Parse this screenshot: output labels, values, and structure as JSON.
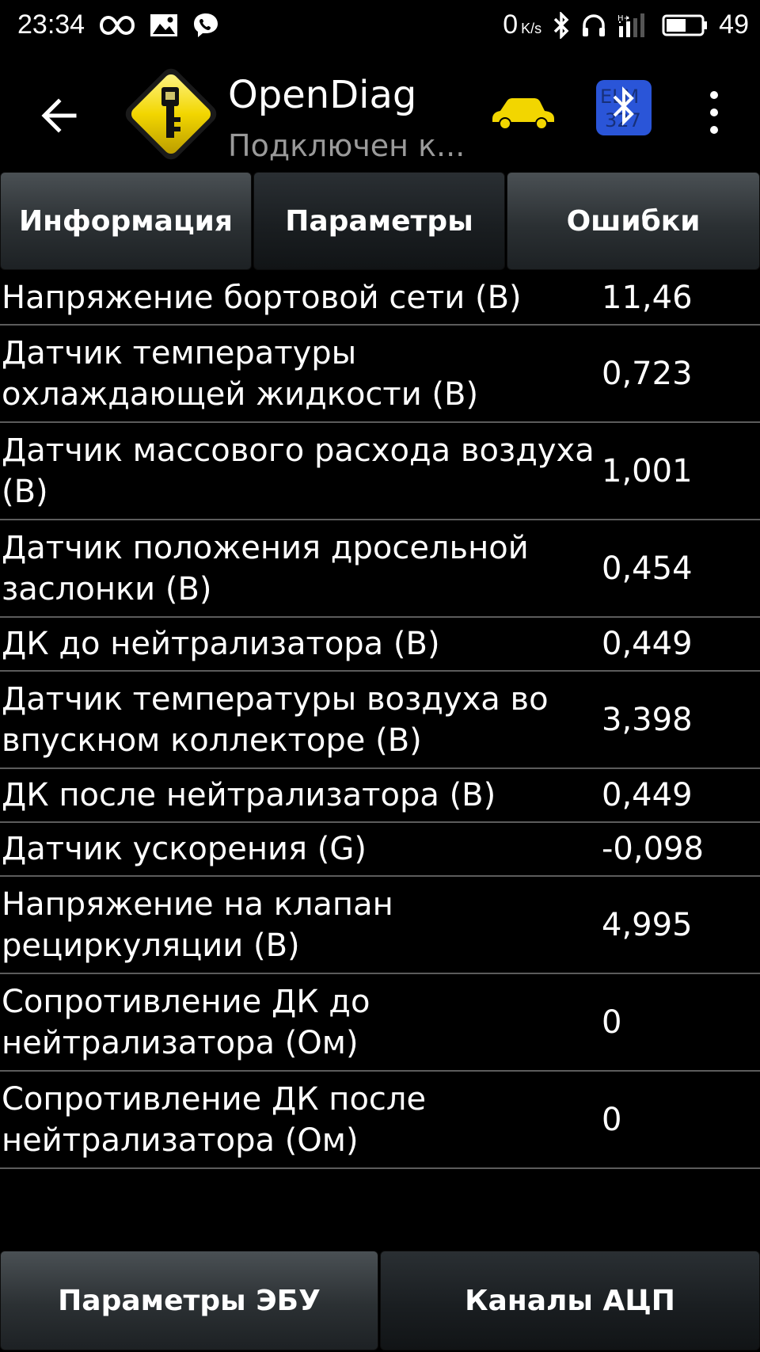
{
  "status_bar": {
    "time": "23:34",
    "net_speed": "0",
    "net_speed_unit": "K/s",
    "battery_level": "49",
    "left_icons": [
      "infinity-icon",
      "image-icon",
      "viber-icon"
    ],
    "right_icons": [
      "bluetooth-icon",
      "headphones-icon",
      "signal-icon",
      "battery-icon"
    ]
  },
  "action_bar": {
    "title": "OpenDiag",
    "subtitle": "Подключен к...",
    "logo_icon": "key-diamond-logo-icon",
    "car_color": "#f2d600",
    "accent": "#f2d600"
  },
  "tabs": [
    {
      "label": "Информация",
      "active": false
    },
    {
      "label": "Параметры",
      "active": true
    },
    {
      "label": "Ошибки",
      "active": false
    }
  ],
  "parameters": [
    {
      "name": "Напряжение бортовой сети (В)",
      "value": "11,46"
    },
    {
      "name": "Датчик температуры охлаждающей жидкости (В)",
      "value": "0,723"
    },
    {
      "name": "Датчик массового расхода воздуха (В)",
      "value": "1,001"
    },
    {
      "name": "Датчик положения дросельной заслонки (В)",
      "value": "0,454"
    },
    {
      "name": "ДК до нейтрализатора (В)",
      "value": "0,449"
    },
    {
      "name": "Датчик температуры воздуха во впускном коллекторе (В)",
      "value": "3,398"
    },
    {
      "name": "ДК после нейтрализатора (В)",
      "value": "0,449"
    },
    {
      "name": "Датчик ускорения (G)",
      "value": "-0,098"
    },
    {
      "name": "Напряжение на клапан рециркуляции (В)",
      "value": "4,995"
    },
    {
      "name": "Сопротивление ДК до нейтрализатора (Ом)",
      "value": "0"
    },
    {
      "name": "Сопротивление ДК после нейтрализатора (Ом)",
      "value": "0"
    }
  ],
  "bottom_buttons": [
    {
      "label": "Параметры ЭБУ",
      "active": false
    },
    {
      "label": "Каналы АЦП",
      "active": true
    }
  ]
}
